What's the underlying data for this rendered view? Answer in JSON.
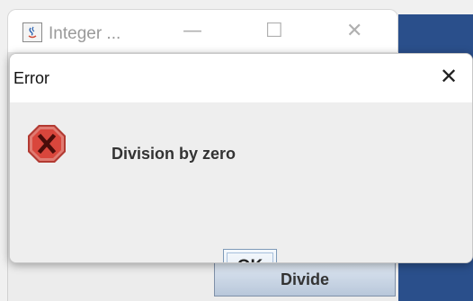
{
  "parent_window": {
    "title": "Integer ...",
    "controls": {
      "minimize": "—",
      "maximize": "☐",
      "close": "✕"
    },
    "divide_label": "Divide"
  },
  "dialog": {
    "title": "Error",
    "close": "✕",
    "icon": "error-icon",
    "message": "Division by zero",
    "ok_label": "OK"
  },
  "colors": {
    "error_red": "#d9463c",
    "button_blue_top": "#dde6f1",
    "button_blue_bottom": "#b8c7da",
    "background_blue": "#2a4f8b"
  }
}
